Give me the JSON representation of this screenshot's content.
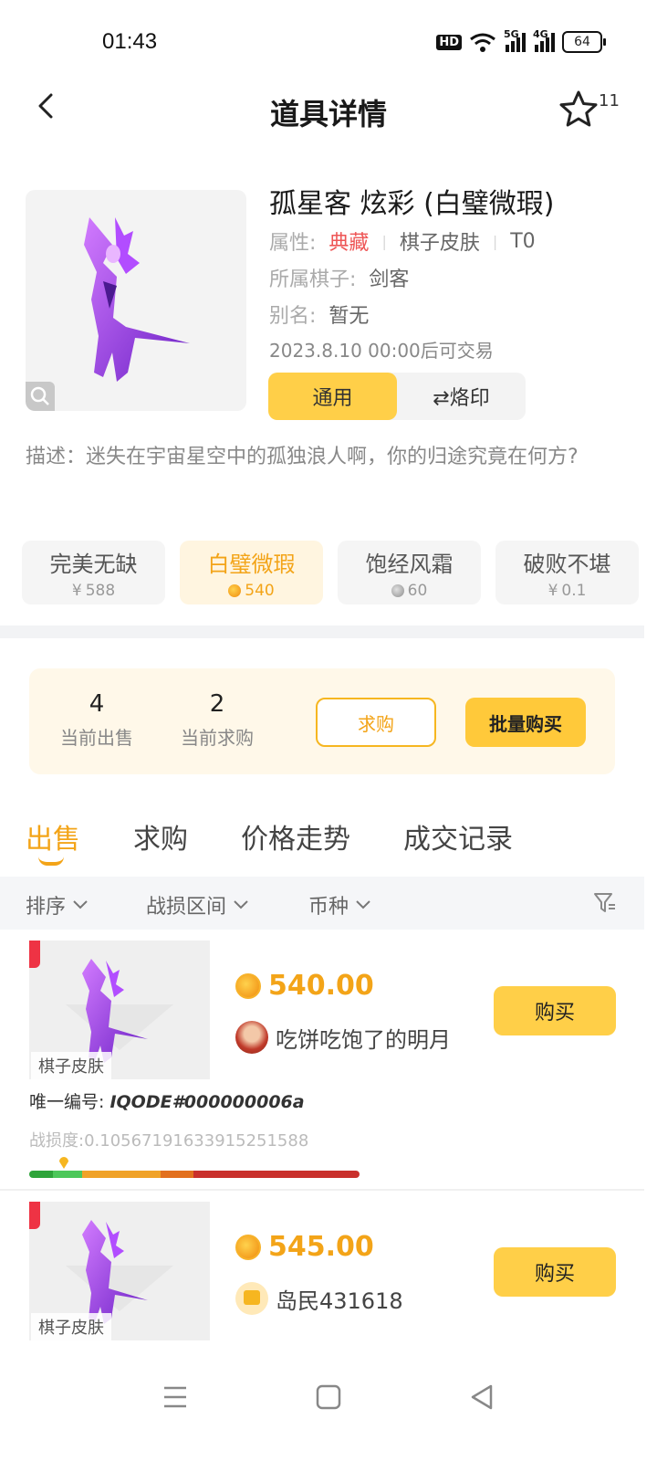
{
  "status": {
    "time": "01:43",
    "hd": "HD",
    "net1": "5G",
    "net2": "4G",
    "battery": "64"
  },
  "nav": {
    "title": "道具详情",
    "fav_count": "11"
  },
  "item": {
    "name": "孤星客 炫彩 (白璧微瑕)",
    "attr_label": "属性:",
    "attr_rarity": "典藏",
    "attr_type": "棋子皮肤",
    "attr_tier": "T0",
    "piece_label": "所属棋子:",
    "piece_value": "剑客",
    "alias_label": "别名:",
    "alias_value": "暂无",
    "trade_time": "2023.8.10 00:00后可交易",
    "mode_general": "通用",
    "mode_brand": "⇄烙印",
    "description": "描述：迷失在宇宙星空中的孤独浪人啊，你的归途究竟在何方?"
  },
  "conditions": [
    {
      "name": "完美无缺",
      "price": "588",
      "currency": "¥"
    },
    {
      "name": "白璧微瑕",
      "price": "540",
      "currency": "gold-coin",
      "active": true
    },
    {
      "name": "饱经风霜",
      "price": "60",
      "currency": "silver-coin"
    },
    {
      "name": "破败不堪",
      "price": "0.1",
      "currency": "¥"
    }
  ],
  "stats": {
    "selling_count": "4",
    "selling_label": "当前出售",
    "buying_count": "2",
    "buying_label": "当前求购",
    "request_button": "求购",
    "batch_buy_button": "批量购买"
  },
  "tabs": [
    "出售",
    "求购",
    "价格走势",
    "成交记录"
  ],
  "filters": {
    "sort": "排序",
    "wear_range": "战损区间",
    "currency": "币种"
  },
  "listings": [
    {
      "tag": "棋子皮肤",
      "price": "540.00",
      "seller": "吃饼吃饱了的明月",
      "buy_label": "购买",
      "uid_label": "唯一编号:",
      "uid": "IQODE#000000006a",
      "wear": "战损度:0.10567191633915251588",
      "wear_value": 0.1057
    },
    {
      "tag": "棋子皮肤",
      "price": "545.00",
      "seller": "岛民431618",
      "buy_label": "购买"
    }
  ],
  "colors": {
    "accent": "#f3a418",
    "button": "#ffcf48",
    "rarity_red": "#ee5555"
  },
  "icons": [
    "back-arrow-icon",
    "star-icon",
    "zoom-icon",
    "chevron-down-icon",
    "filter-icon",
    "coin-icon"
  ]
}
